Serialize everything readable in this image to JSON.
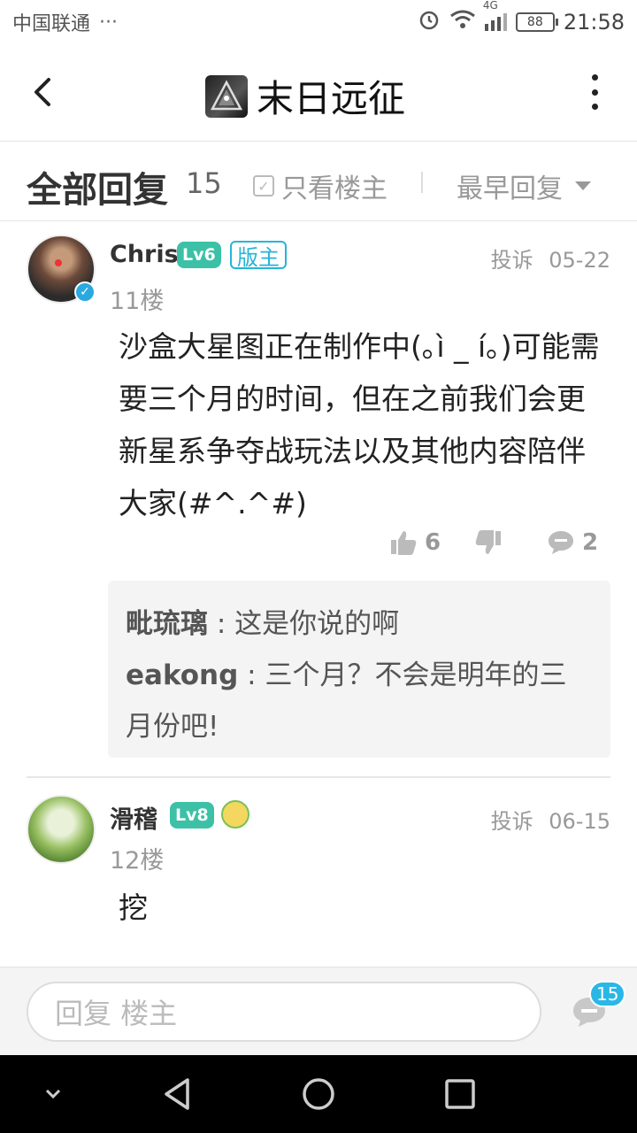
{
  "status_bar": {
    "carrier": "中国联通",
    "dots": "···",
    "network": "4G",
    "battery": "88",
    "time": "21:58"
  },
  "header": {
    "title": "末日远征",
    "logo_icon": "app-logo-icon"
  },
  "filter": {
    "all_replies_label": "全部回复",
    "reply_count": "15",
    "only_op_label": "只看楼主",
    "sort_label": "最早回复"
  },
  "posts": [
    {
      "username": "Chris",
      "level": "Lv6",
      "role": "版主",
      "report": "投诉",
      "date": "05-22",
      "floor": "11楼",
      "content": "沙盒大星图正在制作中(｡ì _ í｡)可能需要三个月的时间，但在之前我们会更新星系争夺战玩法以及其他内容陪伴大家(#^.^#)",
      "likes": "6",
      "comments": "2",
      "sub_replies": [
        {
          "name": "毗琉璃",
          "sep": " : ",
          "text": "这是你说的啊"
        },
        {
          "name": "eakong",
          "sep": " : ",
          "text": "三个月？不会是明年的三月份吧!"
        }
      ]
    },
    {
      "username": "滑稽",
      "level": "Lv8",
      "report": "投诉",
      "date": "06-15",
      "floor": "12楼",
      "content": "挖"
    }
  ],
  "bottom": {
    "input_placeholder": "回复  楼主",
    "comment_badge": "15"
  },
  "colors": {
    "accent": "#27b4d8",
    "level_badge": "#3cc1a6",
    "muted": "#999999"
  }
}
